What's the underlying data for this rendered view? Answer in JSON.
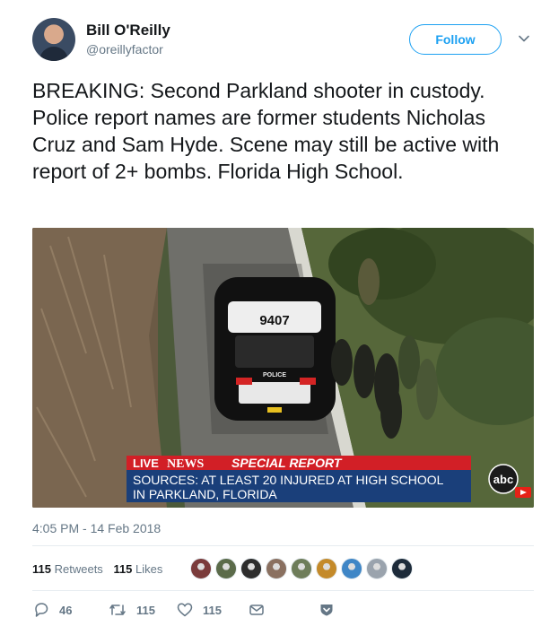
{
  "author": {
    "name": "Bill O'Reilly",
    "handle": "@oreillyfactor"
  },
  "follow_button": {
    "label": "Follow"
  },
  "tweet": {
    "text": "BREAKING: Second Parkland shooter in custody. Police report names are former students Nicholas Cruz and Sam Hyde. Scene may still be active with report of 2+ bombs. Florida High School."
  },
  "media": {
    "car_number": "9407",
    "roof_text": "POLICE",
    "live_label": "LIVE",
    "network_label": "NEWS",
    "special_report": "SPECIAL REPORT",
    "headline_line1": "SOURCES: AT LEAST 20 INJURED AT HIGH SCHOOL",
    "headline_line2": "IN PARKLAND, FLORIDA",
    "network_logo": "abc"
  },
  "timestamp": "4:05 PM - 14 Feb 2018",
  "stats": {
    "retweets_count": "115",
    "retweets_label": "Retweets",
    "likes_count": "115",
    "likes_label": "Likes"
  },
  "likers": [
    "#7a3b3b",
    "#5b6b4a",
    "#2d2d2d",
    "#8a7060",
    "#6e7d5a",
    "#c48a2a",
    "#3f86c6",
    "#9aa3ad",
    "#1d2b3a"
  ],
  "actions": {
    "reply_count": "46",
    "retweet_count": "115",
    "like_count": "115"
  },
  "colors": {
    "accent": "#1da1f2",
    "muted": "#657786",
    "divider": "#e6ecf0"
  }
}
